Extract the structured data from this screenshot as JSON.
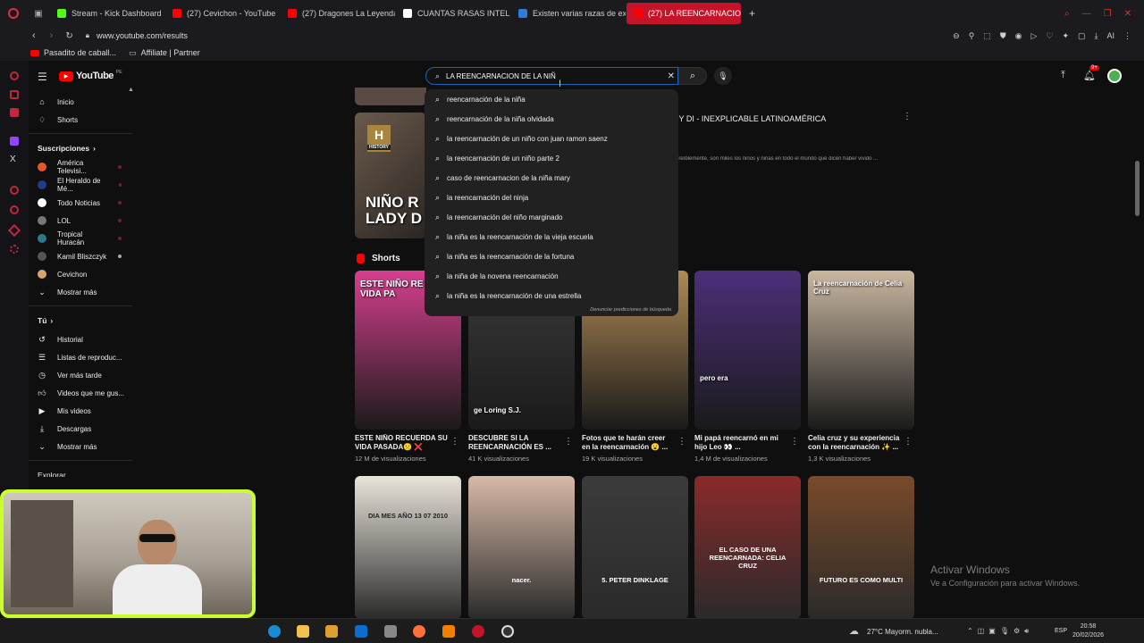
{
  "browser": {
    "tabs": [
      {
        "label": "Stream - Kick Dashboard",
        "color": "#53fc18"
      },
      {
        "label": "(27) Cevichon - YouTube",
        "color": "#ff0000"
      },
      {
        "label": "(27) Dragones La Leyenda",
        "color": "#ff0000"
      },
      {
        "label": "CUANTAS RASAS INTELIG",
        "color": "#ffffff"
      },
      {
        "label": "Existen varias razas de ex",
        "color": "#2f7bd6"
      },
      {
        "label": "(27) LA REENCARNACION",
        "color": "#ff0000"
      }
    ],
    "url": "www.youtube.com/results",
    "bookmarks": [
      "Pasadito de caball...",
      "Affiliate | Partner"
    ]
  },
  "youtube": {
    "logo": "YouTube",
    "country": "PE",
    "search": {
      "value": "LA REENCARNACION DE LA NIÑ",
      "suggestions": [
        "reencarnación de la niña",
        "reencarnación de la niña olvidada",
        "la reencarnación de un niño con juan ramon saenz",
        "la reencarnación de un niño parte 2",
        "caso de reencarnacion de la niña mary",
        "la reencarnación del ninja",
        "la reencarnación del niño marginado",
        "la niña es la reencarnación de la vieja escuela",
        "la niña es la reencarnación de la fortuna",
        "la niña de la novena reencarnación",
        "la niña es la reencarnación de una estrella"
      ],
      "report": "Denunciar predicciones de búsqueda"
    },
    "notifications": "9+",
    "sidebar": {
      "main": [
        "Inicio",
        "Shorts"
      ],
      "subs_title": "Suscripciones",
      "subs": [
        {
          "name": "América Televisi...",
          "color": "#e8542b"
        },
        {
          "name": "El Heraldo de Mé...",
          "color": "#1f3c88"
        },
        {
          "name": "Todo Noticias",
          "color": "#ffffff"
        },
        {
          "name": "LOL",
          "color": "#777777"
        },
        {
          "name": "Tropical Huracán",
          "color": "#2b7a8a"
        },
        {
          "name": "Kamil Bliszczyk",
          "color": "#555555"
        },
        {
          "name": "Cevichon",
          "color": "#d9a36b"
        }
      ],
      "subs_more": "Mostrar más",
      "you_title": "Tú",
      "you": [
        "Historial",
        "Listas de reproduc...",
        "Ver más tarde",
        "Videos que me gus...",
        "Mis videos",
        "Descargas",
        "Mostrar más"
      ],
      "explore": "Explorar"
    },
    "results": {
      "video_title": "LADY DI - INEXPLICABLE LATINOAMÉRICA",
      "video_desc": "... increíblemente, son miles los niños y niñas en todo el mundo que dicen haber vivido ...",
      "thumb_brand": "HISTORY",
      "thumb_text": "NIÑO R LADY D",
      "shorts_title": "Shorts",
      "shorts": [
        {
          "title": "ESTE NIÑO RECUERDA SU VIDA PASADA🙁 ❌ (caso...",
          "views": "12 M de visualizaciones",
          "overlay": "ESTE NIÑO RE SU VIDA PA",
          "bg": "#d63f8f"
        },
        {
          "title": "DESCUBRE SI LA REENCARNACIÓN ES ...",
          "views": "41 K visualizaciones",
          "overlay": "ge Loring S.J.",
          "bg": "#3a3a3a"
        },
        {
          "title": "Fotos que te harán creer en la reencarnación 😮 ...",
          "views": "19 K visualizaciones",
          "overlay": "",
          "bg": "#b08a55"
        },
        {
          "title": "Mi papá reencarnó en mi hijo Leo 👀 ...",
          "views": "1,4 M de visualizaciones",
          "overlay": "pero era",
          "bg": "#4c2f7a"
        },
        {
          "title": "Celia cruz y su experiencia con la reencarnación ✨ ...",
          "views": "1,3 K visualizaciones",
          "overlay": "La reencarnación de Celia Cruz",
          "bg": "#c9b7a0"
        }
      ],
      "shorts_row2": [
        {
          "overlay": "DIA MES AÑO 13 07 2010",
          "bg": "#e9e4da"
        },
        {
          "overlay": "nacer.",
          "bg": "#d9b9a8"
        },
        {
          "overlay": "5. PETER DINKLAGE",
          "bg": "#3b3b3b"
        },
        {
          "overlay": "EL CASO DE UNA REENCARNADA: CELIA CRUZ",
          "bg": "#8a2a2a"
        },
        {
          "overlay": "FUTURO ES COMO MULTI",
          "bg": "#7a4a2a"
        }
      ]
    }
  },
  "windows_watermark": {
    "line1": "Activar Windows",
    "line2": "Ve a Configuración para activar Windows."
  },
  "taskbar": {
    "weather": "27°C  Mayorm. nubla...",
    "lang": "ESP",
    "time": "20:58",
    "date": "20/02/2026"
  }
}
